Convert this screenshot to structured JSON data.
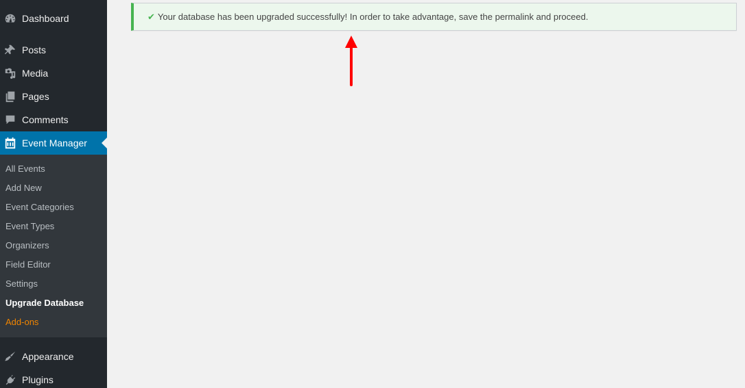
{
  "sidebar": {
    "items": [
      {
        "label": "Dashboard",
        "icon": "dashboard-icon"
      },
      {
        "label": "Posts",
        "icon": "pin-icon"
      },
      {
        "label": "Media",
        "icon": "media-icon"
      },
      {
        "label": "Pages",
        "icon": "pages-icon"
      },
      {
        "label": "Comments",
        "icon": "comment-icon"
      },
      {
        "label": "Event Manager",
        "icon": "calendar-icon",
        "current": true
      },
      {
        "label": "Appearance",
        "icon": "paintbrush-icon"
      },
      {
        "label": "Plugins",
        "icon": "plugin-icon"
      }
    ],
    "submenu": [
      {
        "label": "All Events"
      },
      {
        "label": "Add New"
      },
      {
        "label": "Event Categories"
      },
      {
        "label": "Event Types"
      },
      {
        "label": "Organizers"
      },
      {
        "label": "Field Editor"
      },
      {
        "label": "Settings"
      },
      {
        "label": "Upgrade Database",
        "current": true
      },
      {
        "label": "Add-ons"
      }
    ]
  },
  "notice": {
    "icon": "checkmark-icon",
    "check_glyph": "✔",
    "message": "Your database has been upgraded successfully! In order to take advantage, save the permalink and proceed."
  },
  "annotation": {
    "type": "arrow",
    "color": "#ff0000",
    "direction": "up"
  },
  "colors": {
    "sidebar_bg": "#23282d",
    "submenu_bg": "#32373c",
    "active_bg": "#0073aa",
    "success": "#46b450",
    "addons": "#f18500"
  }
}
